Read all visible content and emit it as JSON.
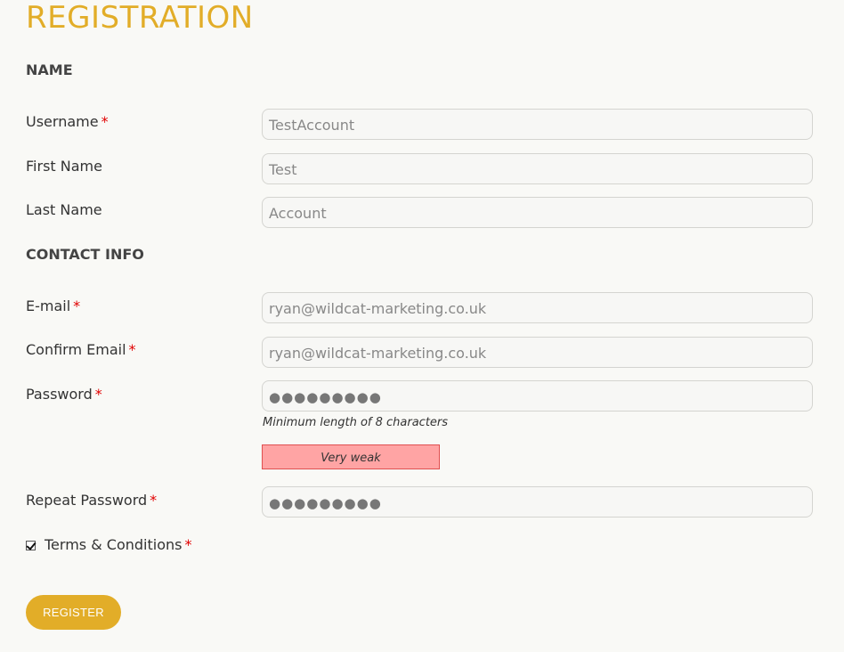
{
  "page": {
    "title": "REGISTRATION",
    "accent_color": "#e2ad28",
    "required_color": "#e10000"
  },
  "sections": {
    "name": "NAME",
    "contact": "CONTACT INFO"
  },
  "fields": {
    "username": {
      "label": "Username",
      "required": "*",
      "value": "TestAccount"
    },
    "first_name": {
      "label": "First Name",
      "value": "Test"
    },
    "last_name": {
      "label": "Last Name",
      "value": "Account"
    },
    "email": {
      "label": "E-mail",
      "required": "*",
      "value": "ryan@wildcat-marketing.co.uk"
    },
    "confirm_email": {
      "label": "Confirm Email",
      "required": "*",
      "value": "ryan@wildcat-marketing.co.uk"
    },
    "password": {
      "label": "Password",
      "required": "*",
      "value": "●●●●●●●●●",
      "hint": "Minimum length of 8 characters",
      "strength": "Very weak",
      "strength_color": "#ffa4a4"
    },
    "repeat_password": {
      "label": "Repeat Password",
      "required": "*",
      "value": "●●●●●●●●●"
    }
  },
  "terms": {
    "label": "Terms & Conditions",
    "required": "*",
    "checked": true
  },
  "register_button": {
    "label": "REGISTER"
  }
}
